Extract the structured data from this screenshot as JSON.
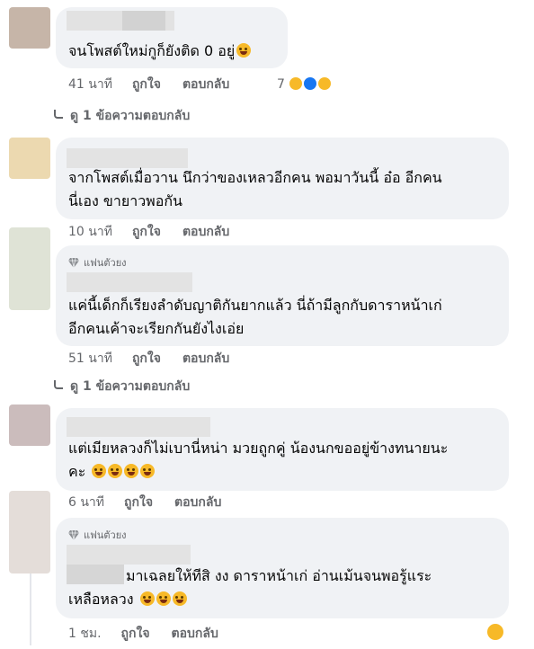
{
  "colors": {
    "bubble": "#f0f2f5",
    "meta_text": "#65676b",
    "text": "#050505",
    "haha": "#f7b928",
    "like": "#1877f2"
  },
  "icons": {
    "emoji": "laughing-rolling-emoji",
    "badge": "diamond-icon"
  },
  "comments": [
    {
      "text_lines": [
        "จนโพสต์ใหม่กูก็ยังติด 0 อยู่"
      ],
      "emoji_count": 1,
      "time": "41 นาที",
      "like": "ถูกใจ",
      "reply": "ตอบกลับ",
      "reaction_count": "7"
    },
    {
      "text_lines": [
        "จากโพสต์เมื่อวาน นึกว่าของเหลวอีกคน พอมาวันนี้ อ๋อ อีกคน",
        "นี่เอง ขายาวพอกัน"
      ],
      "time": "10 นาที",
      "like": "ถูกใจ",
      "reply": "ตอบกลับ"
    },
    {
      "badge": "แฟนตัวยง",
      "text_lines": [
        "แค่นี้เด็กก็เรียงลำดับญาติกันยากแล้ว นี่ถ้ามีลูกกับดาราหน้าเก่",
        "อีกคนเค้าจะเรียกกันยังไงเอ่ย"
      ],
      "time": "51 นาที",
      "like": "ถูกใจ",
      "reply": "ตอบกลับ"
    },
    {
      "text_lines": [
        "แต่เมียหลวงก็ไม่เบานี่หน่า มวยถูกคู่ น้องนกขออยู่ข้างทนายนะ",
        "คะ"
      ],
      "emoji_count": 4,
      "time": "6 นาที",
      "like": "ถูกใจ",
      "reply": "ตอบกลับ"
    },
    {
      "badge": "แฟนตัวยง",
      "text_lines": [
        "มาเฉลยให้ทีสิ งง ดาราหน้าเก่ อ่านเม้นจนพอรู้แระ",
        "เหลือหลวง"
      ],
      "emoji_count": 3,
      "time": "1 ชม.",
      "like": "ถูกใจ",
      "reply": "ตอบกลับ"
    }
  ],
  "view_replies": [
    "ดู 1 ข้อความตอบกลับ",
    "ดู 1 ข้อความตอบกลับ"
  ]
}
